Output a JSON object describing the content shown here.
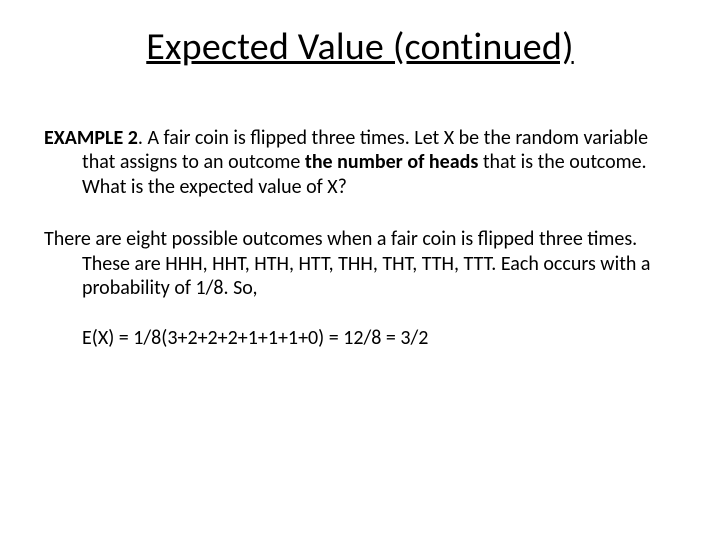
{
  "title": "Expected Value (continued)",
  "example": {
    "label": "EXAMPLE 2",
    "sentence_a": ". A fair coin is flipped three times. Let X be the random variable that assigns to an outcome ",
    "bold_phrase": "the number of heads",
    "sentence_b": " that is the outcome. What is the expected value of X?"
  },
  "explanation": "There are eight possible outcomes when a fair coin is flipped three times. These are HHH, HHT, HTH, HTT, THH, THT, TTH, TTT. Each occurs with a probability of 1/8. So,",
  "formula": "E(X) = 1/8(3+2+2+2+1+1+1+0) =  12/8 = 3/2"
}
